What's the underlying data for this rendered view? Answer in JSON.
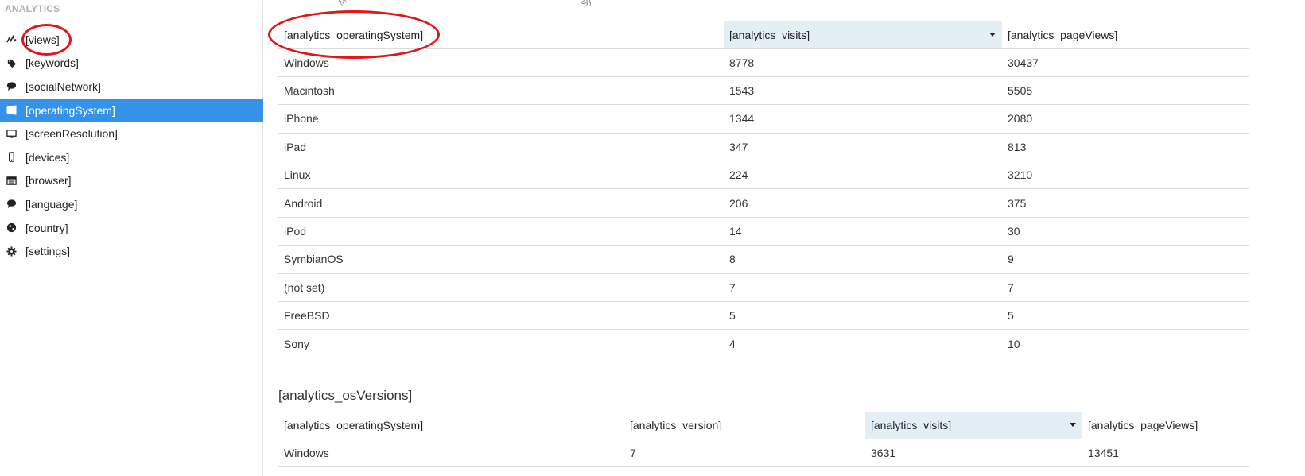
{
  "sidebar": {
    "heading": "ANALYTICS",
    "items": [
      {
        "label": "[views]",
        "icon": "line-chart-icon",
        "active": false
      },
      {
        "label": "[keywords]",
        "icon": "tag-icon",
        "active": false
      },
      {
        "label": "[socialNetwork]",
        "icon": "comment-icon",
        "active": false
      },
      {
        "label": "[operatingSystem]",
        "icon": "windows-icon",
        "active": true
      },
      {
        "label": "[screenResolution]",
        "icon": "monitor-icon",
        "active": false
      },
      {
        "label": "[devices]",
        "icon": "mobile-icon",
        "active": false
      },
      {
        "label": "[browser]",
        "icon": "browser-icon",
        "active": false
      },
      {
        "label": "[language]",
        "icon": "comment-icon",
        "active": false
      },
      {
        "label": "[country]",
        "icon": "globe-icon",
        "active": false
      },
      {
        "label": "[settings]",
        "icon": "gear-icon",
        "active": false
      }
    ]
  },
  "chart_fragments": [
    "M",
    "Sy"
  ],
  "os_table": {
    "columns": [
      "[analytics_operatingSystem]",
      "[analytics_visits]",
      "[analytics_pageViews]"
    ],
    "sorted_column": 1,
    "rows": [
      [
        "Windows",
        "8778",
        "30437"
      ],
      [
        "Macintosh",
        "1543",
        "5505"
      ],
      [
        "iPhone",
        "1344",
        "2080"
      ],
      [
        "iPad",
        "347",
        "813"
      ],
      [
        "Linux",
        "224",
        "3210"
      ],
      [
        "Android",
        "206",
        "375"
      ],
      [
        "iPod",
        "14",
        "30"
      ],
      [
        "SymbianOS",
        "8",
        "9"
      ],
      [
        "(not set)",
        "7",
        "7"
      ],
      [
        "FreeBSD",
        "5",
        "5"
      ],
      [
        "Sony",
        "4",
        "10"
      ]
    ]
  },
  "os_versions": {
    "title": "[analytics_osVersions]",
    "columns": [
      "[analytics_operatingSystem]",
      "[analytics_version]",
      "[analytics_visits]",
      "[analytics_pageViews]"
    ],
    "sorted_column": 2,
    "rows": [
      [
        "Windows",
        "7",
        "3631",
        "13451"
      ]
    ]
  },
  "colors": {
    "active_nav": "#3592e9",
    "sorted_header": "#e3eef5",
    "annotation": "#e0161b"
  }
}
